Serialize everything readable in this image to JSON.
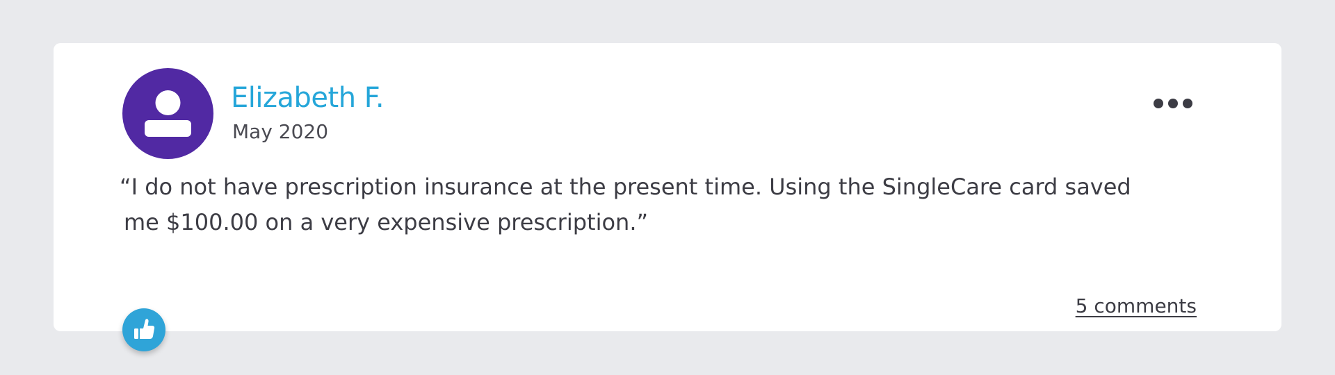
{
  "review": {
    "author_name": "Elizabeth F.",
    "date": "May 2020",
    "quote_line1": "“I do not have prescription insurance at the present time. Using the SingleCare card saved",
    "quote_line2": "me $100.00 on a very expensive prescription.”",
    "comments_link": "5 comments"
  },
  "icons": {
    "avatar": "user-icon",
    "menu": "more-horizontal-icon",
    "like": "thumbs-up-icon"
  },
  "colors": {
    "page_background": "#e9eaed",
    "card_background": "#ffffff",
    "avatar_background": "#5129a3",
    "author_name": "#25a6d9",
    "like_button": "#2fa4d8",
    "text": "#3c3c44"
  }
}
